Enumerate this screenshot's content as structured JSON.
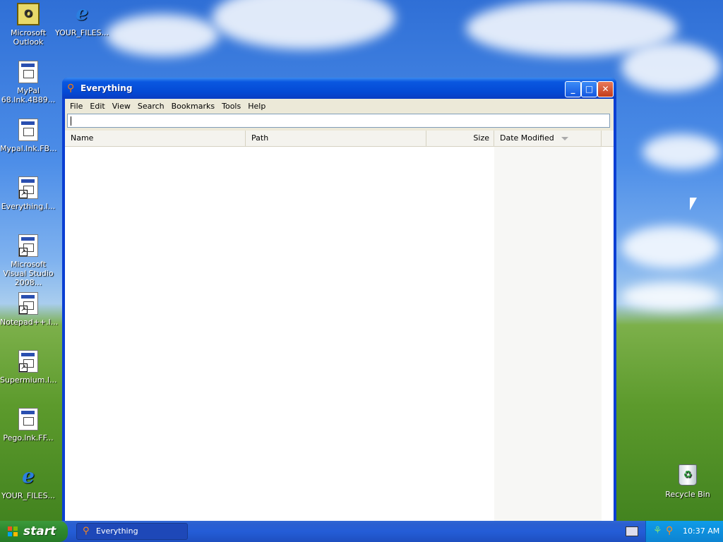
{
  "desktop": {
    "icons": [
      {
        "label": "Microsoft Outlook",
        "icon": "outlook-icon"
      },
      {
        "label": "YOUR_FILES...",
        "icon": "internet-explorer-icon"
      },
      {
        "label": "MyPal 68.lnk.4B89...",
        "icon": "program-icon"
      },
      {
        "label": "Mypal.lnk.FB...",
        "icon": "program-icon"
      },
      {
        "label": "Everything.l...",
        "icon": "program-shortcut-icon"
      },
      {
        "label": "Microsoft Visual Studio 2008...",
        "icon": "program-shortcut-icon"
      },
      {
        "label": "Notepad++.l...",
        "icon": "program-shortcut-icon"
      },
      {
        "label": "Supermium.l...",
        "icon": "program-shortcut-icon"
      },
      {
        "label": "Pego.lnk.FF...",
        "icon": "program-icon"
      },
      {
        "label": "YOUR_FILES...",
        "icon": "internet-explorer-icon"
      },
      {
        "label": "Recycle Bin",
        "icon": "recycle-bin-icon"
      }
    ]
  },
  "window": {
    "title": "Everything",
    "menu": [
      "File",
      "Edit",
      "View",
      "Search",
      "Bookmarks",
      "Tools",
      "Help"
    ],
    "search": {
      "value": ""
    },
    "columns": {
      "name": "Name",
      "path": "Path",
      "size": "Size",
      "date_modified": "Date Modified"
    },
    "sort": {
      "column": "Date Modified",
      "direction": "descending"
    }
  },
  "taskbar": {
    "start_label": "start",
    "task_button": "Everything",
    "clock": "10:37 AM"
  },
  "colors": {
    "titlebar": "#0a58e0",
    "taskbar": "#245dd7",
    "start": "#2f8a2f",
    "tray": "#0d84d2"
  }
}
